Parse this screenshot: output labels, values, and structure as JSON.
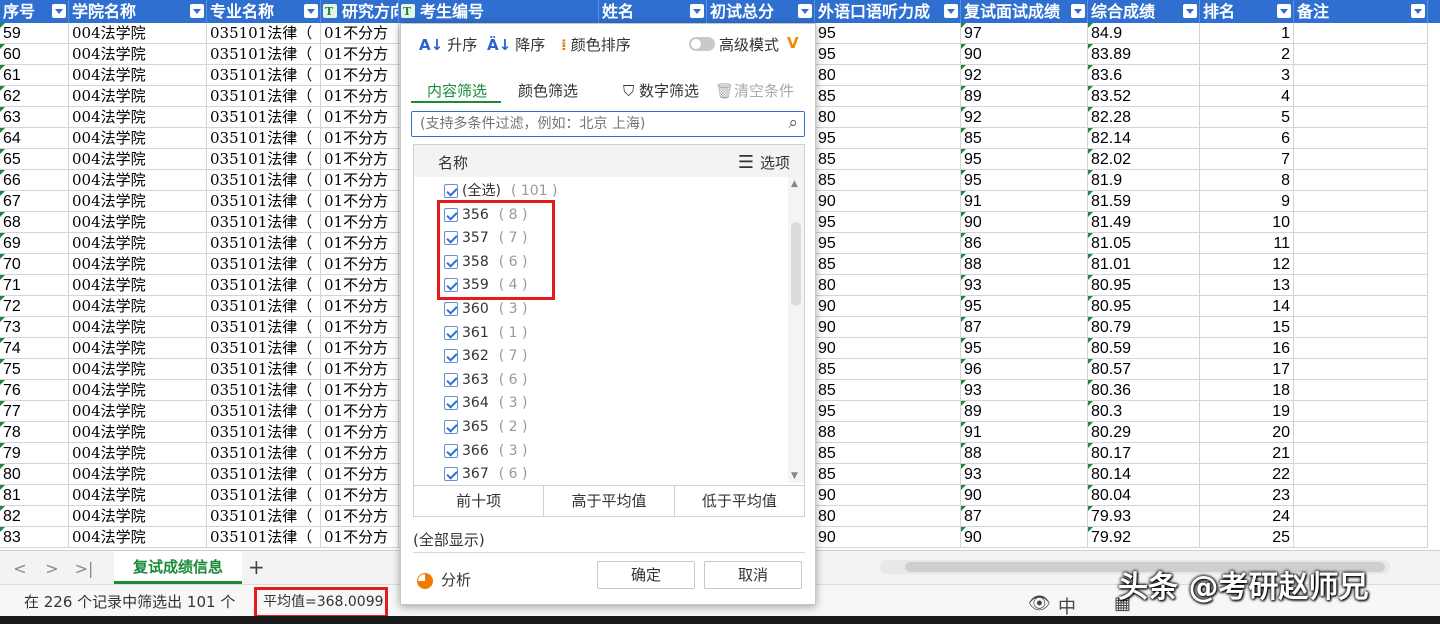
{
  "headers": [
    "序号",
    "学院名称",
    "专业名称",
    "研究方向",
    "考生编号",
    "姓名",
    "初试总分",
    "外语口语听力成",
    "复试面试成绩",
    "综合成绩",
    "排名",
    "备注"
  ],
  "rows": [
    [
      "59",
      "004法学院",
      "035101法律（",
      "01不分方",
      "95",
      "97",
      "84.9",
      "1"
    ],
    [
      "60",
      "004法学院",
      "035101法律（",
      "01不分方",
      "95",
      "90",
      "83.89",
      "2"
    ],
    [
      "61",
      "004法学院",
      "035101法律（",
      "01不分方",
      "80",
      "92",
      "83.6",
      "3"
    ],
    [
      "62",
      "004法学院",
      "035101法律（",
      "01不分方",
      "85",
      "89",
      "83.52",
      "4"
    ],
    [
      "63",
      "004法学院",
      "035101法律（",
      "01不分方",
      "80",
      "92",
      "82.28",
      "5"
    ],
    [
      "64",
      "004法学院",
      "035101法律（",
      "01不分方",
      "95",
      "85",
      "82.14",
      "6"
    ],
    [
      "65",
      "004法学院",
      "035101法律（",
      "01不分方",
      "85",
      "95",
      "82.02",
      "7"
    ],
    [
      "66",
      "004法学院",
      "035101法律（",
      "01不分方",
      "85",
      "95",
      "81.9",
      "8"
    ],
    [
      "67",
      "004法学院",
      "035101法律（",
      "01不分方",
      "90",
      "91",
      "81.59",
      "9"
    ],
    [
      "68",
      "004法学院",
      "035101法律（",
      "01不分方",
      "95",
      "90",
      "81.49",
      "10"
    ],
    [
      "69",
      "004法学院",
      "035101法律（",
      "01不分方",
      "95",
      "86",
      "81.05",
      "11"
    ],
    [
      "70",
      "004法学院",
      "035101法律（",
      "01不分方",
      "85",
      "88",
      "81.01",
      "12"
    ],
    [
      "71",
      "004法学院",
      "035101法律（",
      "01不分方",
      "80",
      "93",
      "80.95",
      "13"
    ],
    [
      "72",
      "004法学院",
      "035101法律（",
      "01不分方",
      "90",
      "95",
      "80.95",
      "14"
    ],
    [
      "73",
      "004法学院",
      "035101法律（",
      "01不分方",
      "90",
      "87",
      "80.79",
      "15"
    ],
    [
      "74",
      "004法学院",
      "035101法律（",
      "01不分方",
      "90",
      "95",
      "80.59",
      "16"
    ],
    [
      "75",
      "004法学院",
      "035101法律（",
      "01不分方",
      "85",
      "96",
      "80.57",
      "17"
    ],
    [
      "76",
      "004法学院",
      "035101法律（",
      "01不分方",
      "85",
      "93",
      "80.36",
      "18"
    ],
    [
      "77",
      "004法学院",
      "035101法律（",
      "01不分方",
      "95",
      "89",
      "80.3",
      "19"
    ],
    [
      "78",
      "004法学院",
      "035101法律（",
      "01不分方",
      "88",
      "91",
      "80.29",
      "20"
    ],
    [
      "79",
      "004法学院",
      "035101法律（",
      "01不分方",
      "85",
      "88",
      "80.17",
      "21"
    ],
    [
      "80",
      "004法学院",
      "035101法律（",
      "01不分方",
      "85",
      "93",
      "80.14",
      "22"
    ],
    [
      "81",
      "004法学院",
      "035101法律（",
      "01不分方",
      "90",
      "90",
      "80.04",
      "23"
    ],
    [
      "82",
      "004法学院",
      "035101法律（",
      "01不分方",
      "80",
      "87",
      "79.93",
      "24"
    ],
    [
      "83",
      "004法学院",
      "035101法律（",
      "01不分方",
      "90",
      "90",
      "79.92",
      "25"
    ]
  ],
  "popup": {
    "sort_asc": "升序",
    "sort_desc": "降序",
    "color_sort": "颜色排序",
    "advanced_mode": "高级模式",
    "advanced_mark": "V",
    "tab_content": "内容筛选",
    "tab_color": "颜色筛选",
    "number_filter": "数字筛选",
    "clear_filter": "清空条件",
    "search_placeholder": "(支持多条件过滤，例如：北京 上海)",
    "list_header_name": "名称",
    "list_header_options": "选项",
    "items": [
      {
        "label": "(全选)",
        "count": "( 101 )"
      },
      {
        "label": "356",
        "count": "( 8 )"
      },
      {
        "label": "357",
        "count": "( 7 )"
      },
      {
        "label": "358",
        "count": "( 6 )"
      },
      {
        "label": "359",
        "count": "( 4 )"
      },
      {
        "label": "360",
        "count": "( 3 )"
      },
      {
        "label": "361",
        "count": "( 1 )"
      },
      {
        "label": "362",
        "count": "( 7 )"
      },
      {
        "label": "363",
        "count": "( 6 )"
      },
      {
        "label": "364",
        "count": "( 3 )"
      },
      {
        "label": "365",
        "count": "( 2 )"
      },
      {
        "label": "366",
        "count": "( 3 )"
      },
      {
        "label": "367",
        "count": "( 6 )"
      }
    ],
    "top10": "前十项",
    "above_avg": "高于平均值",
    "below_avg": "低于平均值",
    "show_all": "(全部显示)",
    "analyze": "分析",
    "ok": "确定",
    "cancel": "取消"
  },
  "sheet_tab": "复试成绩信息",
  "status": {
    "filter_info": "在 226 个记录中筛选出 101 个",
    "average": "平均值=368.0099"
  },
  "watermark": "头条 @考研赵师兄",
  "colors": {
    "header_bg": "#2f6fd0",
    "accent_green": "#1a8a3a",
    "highlight_red": "#e31d1d"
  }
}
